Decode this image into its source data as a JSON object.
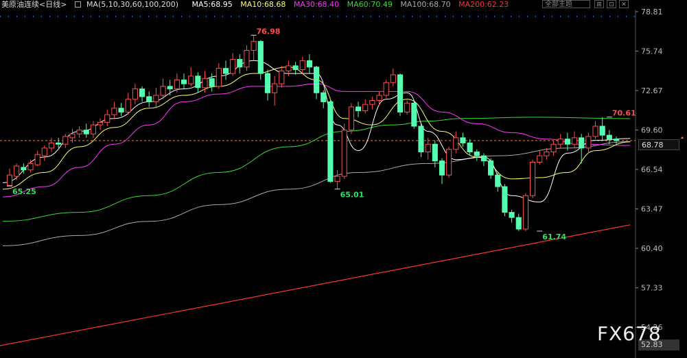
{
  "toolbar": {
    "title": "美原油连续",
    "period": "<日线>",
    "ma_params": "MA(5,10,30,60,100,200)",
    "ma5": "MA5:68.95",
    "ma10": "MA10:68.68",
    "ma30": "MA30:68.40",
    "ma60": "MA60:70.49",
    "ma100": "MA100:68.70",
    "ma200": "MA200:62.23",
    "selector": "全部主题",
    "colors": {
      "ma5": "#ffffff",
      "ma10": "#ffff66",
      "ma30": "#ff33ff",
      "ma60": "#33dd33",
      "ma100": "#aaaaaa",
      "ma200": "#ff3333",
      "up": "#ff5050",
      "down": "#54ffb0"
    }
  },
  "watermark": "FX678",
  "current_price_tag": "68.78",
  "bottom_tag": "52.83",
  "chart_data": {
    "type": "candlestick",
    "y_ticks": [
      78.81,
      75.74,
      72.67,
      69.6,
      66.54,
      63.47,
      60.4,
      57.33,
      54.26
    ],
    "ylim": [
      52.83,
      78.81
    ],
    "current_price": 68.78,
    "annotations": [
      {
        "label": "76.98",
        "value": 76.98,
        "index": 35,
        "kind": "high"
      },
      {
        "label": "65.25",
        "value": 65.25,
        "index": 0,
        "kind": "low"
      },
      {
        "label": "65.01",
        "value": 65.01,
        "index": 47,
        "kind": "low"
      },
      {
        "label": "61.74",
        "value": 61.74,
        "index": 76,
        "kind": "low"
      },
      {
        "label": "70.61",
        "value": 70.61,
        "index": 86,
        "kind": "high"
      }
    ],
    "candles": [
      [
        65.3,
        66.1,
        65.25,
        66.6
      ],
      [
        66.0,
        66.8,
        65.7,
        67.0
      ],
      [
        66.7,
        66.5,
        66.2,
        67.0
      ],
      [
        66.5,
        67.0,
        66.3,
        67.3
      ],
      [
        66.9,
        67.7,
        66.8,
        68.0
      ],
      [
        67.6,
        68.2,
        67.2,
        68.4
      ],
      [
        68.2,
        68.6,
        67.9,
        69.0
      ],
      [
        68.6,
        68.5,
        68.2,
        69.0
      ],
      [
        68.5,
        69.1,
        68.2,
        69.3
      ],
      [
        69.0,
        69.3,
        68.6,
        69.7
      ],
      [
        69.3,
        69.6,
        69.0,
        69.9
      ],
      [
        69.6,
        69.3,
        69.0,
        70.1
      ],
      [
        69.3,
        70.0,
        69.0,
        70.3
      ],
      [
        70.0,
        70.2,
        69.6,
        70.5
      ],
      [
        70.2,
        70.8,
        69.9,
        71.2
      ],
      [
        70.8,
        71.3,
        70.5,
        71.8
      ],
      [
        71.3,
        71.0,
        70.7,
        71.7
      ],
      [
        71.0,
        72.0,
        70.8,
        72.5
      ],
      [
        72.0,
        72.8,
        71.6,
        73.2
      ],
      [
        72.8,
        72.2,
        71.8,
        73.0
      ],
      [
        72.2,
        71.8,
        71.4,
        72.6
      ],
      [
        71.8,
        72.3,
        71.3,
        72.9
      ],
      [
        72.3,
        73.0,
        72.0,
        73.6
      ],
      [
        73.0,
        72.8,
        72.3,
        73.5
      ],
      [
        72.8,
        73.5,
        72.5,
        74.0
      ],
      [
        73.5,
        73.2,
        72.8,
        74.0
      ],
      [
        73.2,
        73.8,
        73.0,
        74.5
      ],
      [
        73.8,
        72.9,
        72.5,
        74.1
      ],
      [
        72.9,
        73.6,
        72.5,
        74.2
      ],
      [
        73.6,
        73.0,
        72.6,
        74.0
      ],
      [
        73.0,
        74.4,
        72.8,
        74.8
      ],
      [
        74.4,
        74.0,
        73.5,
        75.0
      ],
      [
        74.0,
        75.1,
        73.8,
        75.6
      ],
      [
        75.1,
        74.5,
        74.0,
        75.5
      ],
      [
        74.5,
        75.8,
        74.2,
        76.2
      ],
      [
        75.8,
        76.5,
        75.0,
        76.98
      ],
      [
        76.5,
        74.0,
        73.5,
        76.6
      ],
      [
        74.0,
        72.5,
        71.9,
        74.3
      ],
      [
        72.5,
        73.2,
        71.5,
        73.8
      ],
      [
        73.2,
        74.2,
        72.9,
        74.6
      ],
      [
        74.2,
        74.6,
        73.8,
        75.0
      ],
      [
        74.6,
        74.3,
        73.9,
        74.9
      ],
      [
        74.3,
        75.0,
        74.0,
        75.3
      ],
      [
        75.0,
        74.5,
        74.0,
        75.5
      ],
      [
        74.5,
        72.5,
        72.0,
        74.6
      ],
      [
        72.5,
        71.8,
        71.3,
        72.7
      ],
      [
        71.8,
        65.6,
        65.5,
        71.9
      ],
      [
        65.6,
        66.0,
        65.01,
        66.5
      ],
      [
        66.0,
        69.6,
        65.8,
        70.1
      ],
      [
        69.6,
        71.4,
        69.3,
        71.7
      ],
      [
        71.4,
        71.1,
        70.6,
        71.8
      ],
      [
        71.1,
        71.6,
        70.9,
        72.0
      ],
      [
        71.6,
        71.9,
        71.2,
        72.2
      ],
      [
        71.9,
        72.3,
        71.5,
        72.6
      ],
      [
        72.3,
        73.3,
        72.1,
        73.5
      ],
      [
        73.3,
        73.9,
        73.0,
        74.4
      ],
      [
        73.9,
        71.0,
        70.7,
        74.0
      ],
      [
        71.0,
        71.7,
        70.8,
        71.9
      ],
      [
        71.7,
        69.9,
        69.7,
        71.8
      ],
      [
        69.9,
        67.9,
        67.5,
        70.1
      ],
      [
        67.9,
        68.5,
        67.3,
        69.0
      ],
      [
        68.5,
        67.2,
        66.7,
        68.8
      ],
      [
        67.2,
        66.1,
        65.4,
        67.4
      ],
      [
        66.1,
        68.1,
        65.9,
        68.3
      ],
      [
        68.1,
        69.0,
        67.8,
        69.5
      ],
      [
        69.0,
        68.6,
        68.3,
        69.4
      ],
      [
        68.6,
        67.9,
        67.6,
        68.9
      ],
      [
        67.9,
        67.6,
        67.2,
        68.1
      ],
      [
        67.6,
        67.2,
        66.8,
        67.8
      ],
      [
        67.2,
        66.1,
        65.8,
        67.4
      ],
      [
        66.1,
        65.2,
        64.8,
        66.3
      ],
      [
        65.2,
        63.2,
        62.9,
        65.4
      ],
      [
        63.2,
        62.8,
        62.4,
        63.4
      ],
      [
        62.8,
        61.9,
        61.74,
        63.1
      ],
      [
        61.9,
        64.5,
        61.74,
        64.7
      ],
      [
        64.5,
        67.1,
        64.3,
        67.3
      ],
      [
        67.1,
        67.6,
        66.9,
        68.0
      ],
      [
        67.6,
        67.9,
        67.3,
        68.2
      ],
      [
        67.9,
        68.5,
        67.6,
        68.8
      ],
      [
        68.5,
        68.9,
        68.2,
        69.3
      ],
      [
        68.9,
        68.5,
        68.0,
        69.4
      ],
      [
        68.5,
        69.0,
        68.2,
        69.5
      ],
      [
        69.0,
        68.2,
        67.0,
        69.3
      ],
      [
        68.2,
        69.1,
        67.8,
        69.4
      ],
      [
        69.1,
        69.9,
        68.9,
        70.3
      ],
      [
        69.9,
        69.2,
        68.8,
        70.61
      ],
      [
        69.2,
        68.9,
        68.5,
        69.6
      ],
      [
        68.9,
        68.78,
        68.5,
        69.1
      ]
    ],
    "ma_lines": {
      "ma200": {
        "name": "MA200",
        "start": [
          0,
          52.83
        ],
        "end": [
          89,
          62.23
        ]
      },
      "ma100": [
        [
          0,
          60.6
        ],
        [
          10,
          61.4
        ],
        [
          20,
          62.5
        ],
        [
          30,
          63.8
        ],
        [
          40,
          65.0
        ],
        [
          50,
          66.3
        ],
        [
          60,
          67.0
        ],
        [
          70,
          67.6
        ],
        [
          80,
          68.2
        ],
        [
          89,
          68.7
        ]
      ],
      "ma60": [
        [
          0,
          62.5
        ],
        [
          10,
          63.2
        ],
        [
          20,
          64.5
        ],
        [
          30,
          66.3
        ],
        [
          40,
          68.3
        ],
        [
          48,
          69.5
        ],
        [
          55,
          70.0
        ],
        [
          60,
          70.3
        ],
        [
          65,
          70.5
        ],
        [
          75,
          70.6
        ],
        [
          89,
          70.49
        ]
      ],
      "ma30": [
        [
          0,
          64.4
        ],
        [
          5,
          65.2
        ],
        [
          10,
          66.7
        ],
        [
          15,
          68.5
        ],
        [
          20,
          70.0
        ],
        [
          25,
          71.8
        ],
        [
          30,
          72.4
        ],
        [
          35,
          73.0
        ],
        [
          40,
          73.0
        ],
        [
          44,
          73.2
        ],
        [
          48,
          72.6
        ],
        [
          52,
          72.6
        ],
        [
          57,
          72.6
        ],
        [
          62,
          71.0
        ],
        [
          67,
          70.1
        ],
        [
          72,
          69.4
        ],
        [
          77,
          68.9
        ],
        [
          82,
          68.5
        ],
        [
          89,
          68.4
        ]
      ],
      "ma10": [
        [
          0,
          65.0
        ],
        [
          5,
          66.3
        ],
        [
          10,
          68.3
        ],
        [
          15,
          69.8
        ],
        [
          20,
          71.3
        ],
        [
          25,
          72.3
        ],
        [
          30,
          73.0
        ],
        [
          35,
          74.0
        ],
        [
          40,
          74.5
        ],
        [
          44,
          73.5
        ],
        [
          48,
          70.5
        ],
        [
          52,
          70.0
        ],
        [
          57,
          72.0
        ],
        [
          62,
          69.5
        ],
        [
          67,
          67.5
        ],
        [
          72,
          65.8
        ],
        [
          76,
          65.9
        ],
        [
          80,
          66.3
        ],
        [
          84,
          68.0
        ],
        [
          89,
          68.68
        ]
      ],
      "ma5": [
        [
          0,
          65.5
        ],
        [
          5,
          67.5
        ],
        [
          10,
          69.5
        ],
        [
          15,
          70.5
        ],
        [
          20,
          71.8
        ],
        [
          25,
          72.8
        ],
        [
          30,
          73.8
        ],
        [
          35,
          75.0
        ],
        [
          40,
          74.0
        ],
        [
          44,
          74.0
        ],
        [
          47,
          70.0
        ],
        [
          50,
          68.0
        ],
        [
          54,
          72.0
        ],
        [
          57,
          72.5
        ],
        [
          60,
          69.5
        ],
        [
          64,
          67.3
        ],
        [
          68,
          67.5
        ],
        [
          72,
          64.5
        ],
        [
          76,
          64.0
        ],
        [
          80,
          67.8
        ],
        [
          84,
          68.8
        ],
        [
          89,
          68.95
        ]
      ]
    }
  }
}
